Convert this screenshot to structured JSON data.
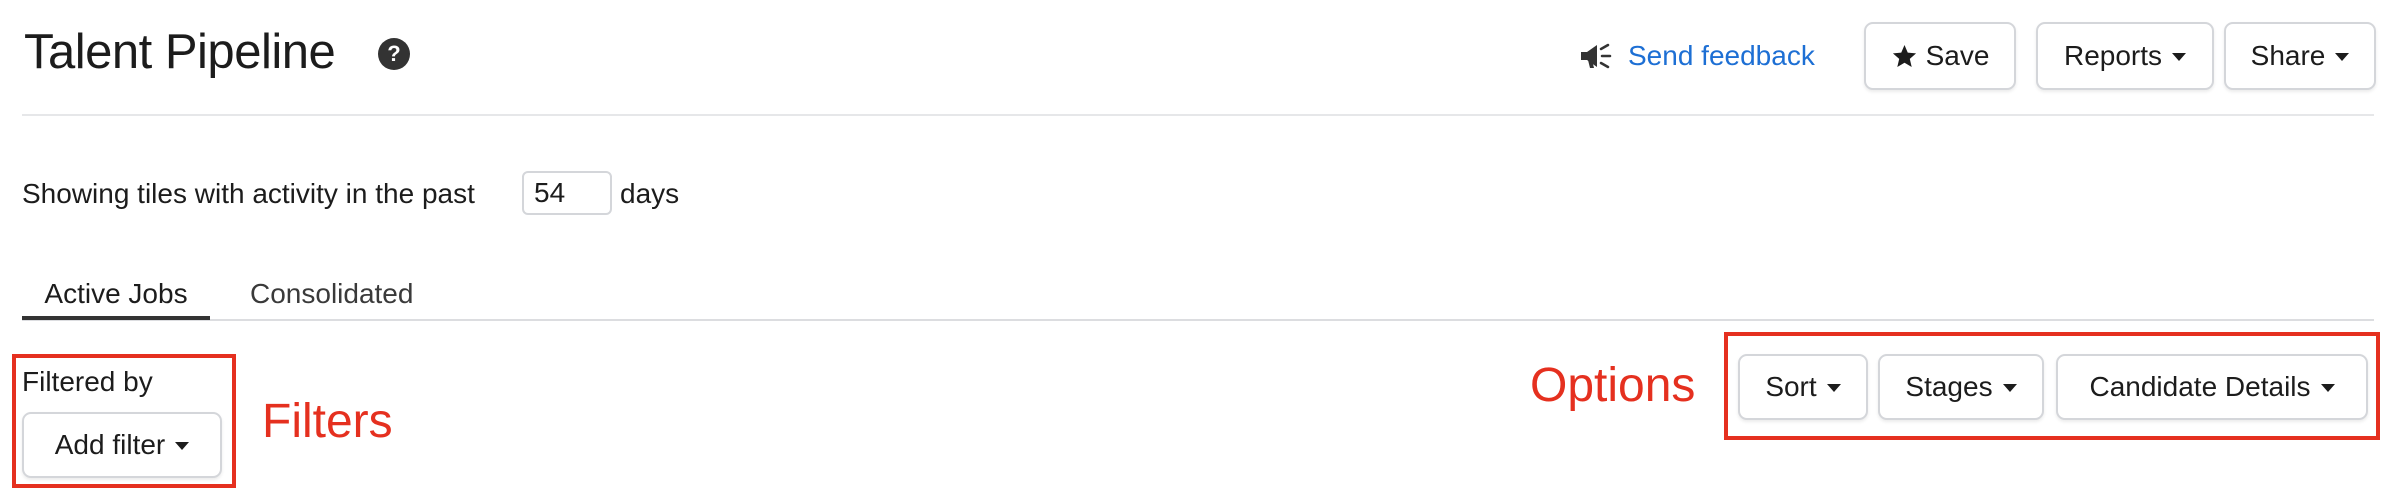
{
  "header": {
    "title": "Talent Pipeline",
    "help_icon": "question-circle-icon",
    "feedback_icon": "megaphone-icon",
    "feedback_label": "Send feedback",
    "save_label": "Save",
    "save_icon": "star-icon",
    "reports_label": "Reports",
    "share_label": "Share"
  },
  "activity": {
    "prefix": "Showing tiles with activity in the past",
    "days_value": "54",
    "suffix": "days"
  },
  "tabs": [
    {
      "label": "Active Jobs",
      "active": true
    },
    {
      "label": "Consolidated",
      "active": false
    }
  ],
  "filters": {
    "heading": "Filtered by",
    "add_filter_label": "Add filter"
  },
  "options": {
    "sort_label": "Sort",
    "stages_label": "Stages",
    "candidate_details_label": "Candidate Details"
  },
  "annotations": {
    "filters_label": "Filters",
    "options_label": "Options",
    "color": "#e5301f"
  },
  "colors": {
    "link": "#1d6fd4",
    "text": "#1c1c1c",
    "border": "#d4d6da"
  }
}
